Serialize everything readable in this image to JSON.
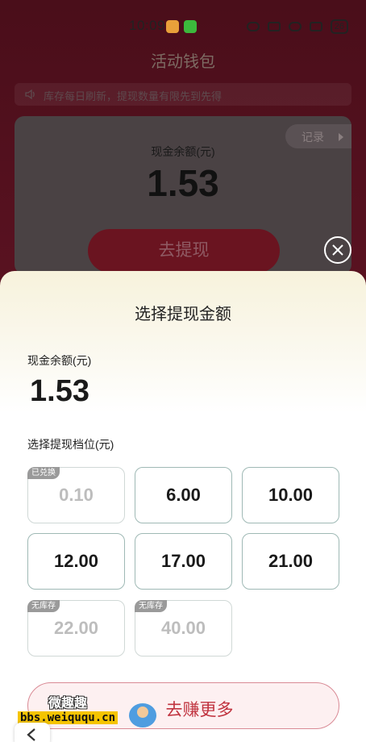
{
  "status_bar": {
    "time": "10:09",
    "battery": "26"
  },
  "page": {
    "title": "活动钱包",
    "notice": "库存每日刷新，提现数量有限先到先得",
    "records_label": "记录",
    "balance_label": "现金余额(元)",
    "balance_value": "1.53",
    "withdraw_button": "去提现"
  },
  "sheet": {
    "title": "选择提现金额",
    "balance_label": "现金余额(元)",
    "balance_value": "1.53",
    "tier_label": "选择提现档位(元)",
    "tiers": [
      {
        "amount": "0.10",
        "badge": "已兑换",
        "enabled": false
      },
      {
        "amount": "6.00",
        "badge": "",
        "enabled": true
      },
      {
        "amount": "10.00",
        "badge": "",
        "enabled": true
      },
      {
        "amount": "12.00",
        "badge": "",
        "enabled": true
      },
      {
        "amount": "17.00",
        "badge": "",
        "enabled": true
      },
      {
        "amount": "21.00",
        "badge": "",
        "enabled": true
      },
      {
        "amount": "22.00",
        "badge": "无库存",
        "enabled": false
      },
      {
        "amount": "40.00",
        "badge": "无库存",
        "enabled": false
      }
    ],
    "earn_more_button": "去赚更多"
  },
  "watermark": {
    "top": "微趣趣",
    "bottom": "bbs.weiququ.cn"
  },
  "icons": [
    "weibo-icon",
    "wechat-icon",
    "eye-icon",
    "alarm-icon",
    "wifi-icon",
    "signal-icon",
    "speaker-icon",
    "play-arrow-icon",
    "close-icon",
    "back-chevron-icon"
  ]
}
